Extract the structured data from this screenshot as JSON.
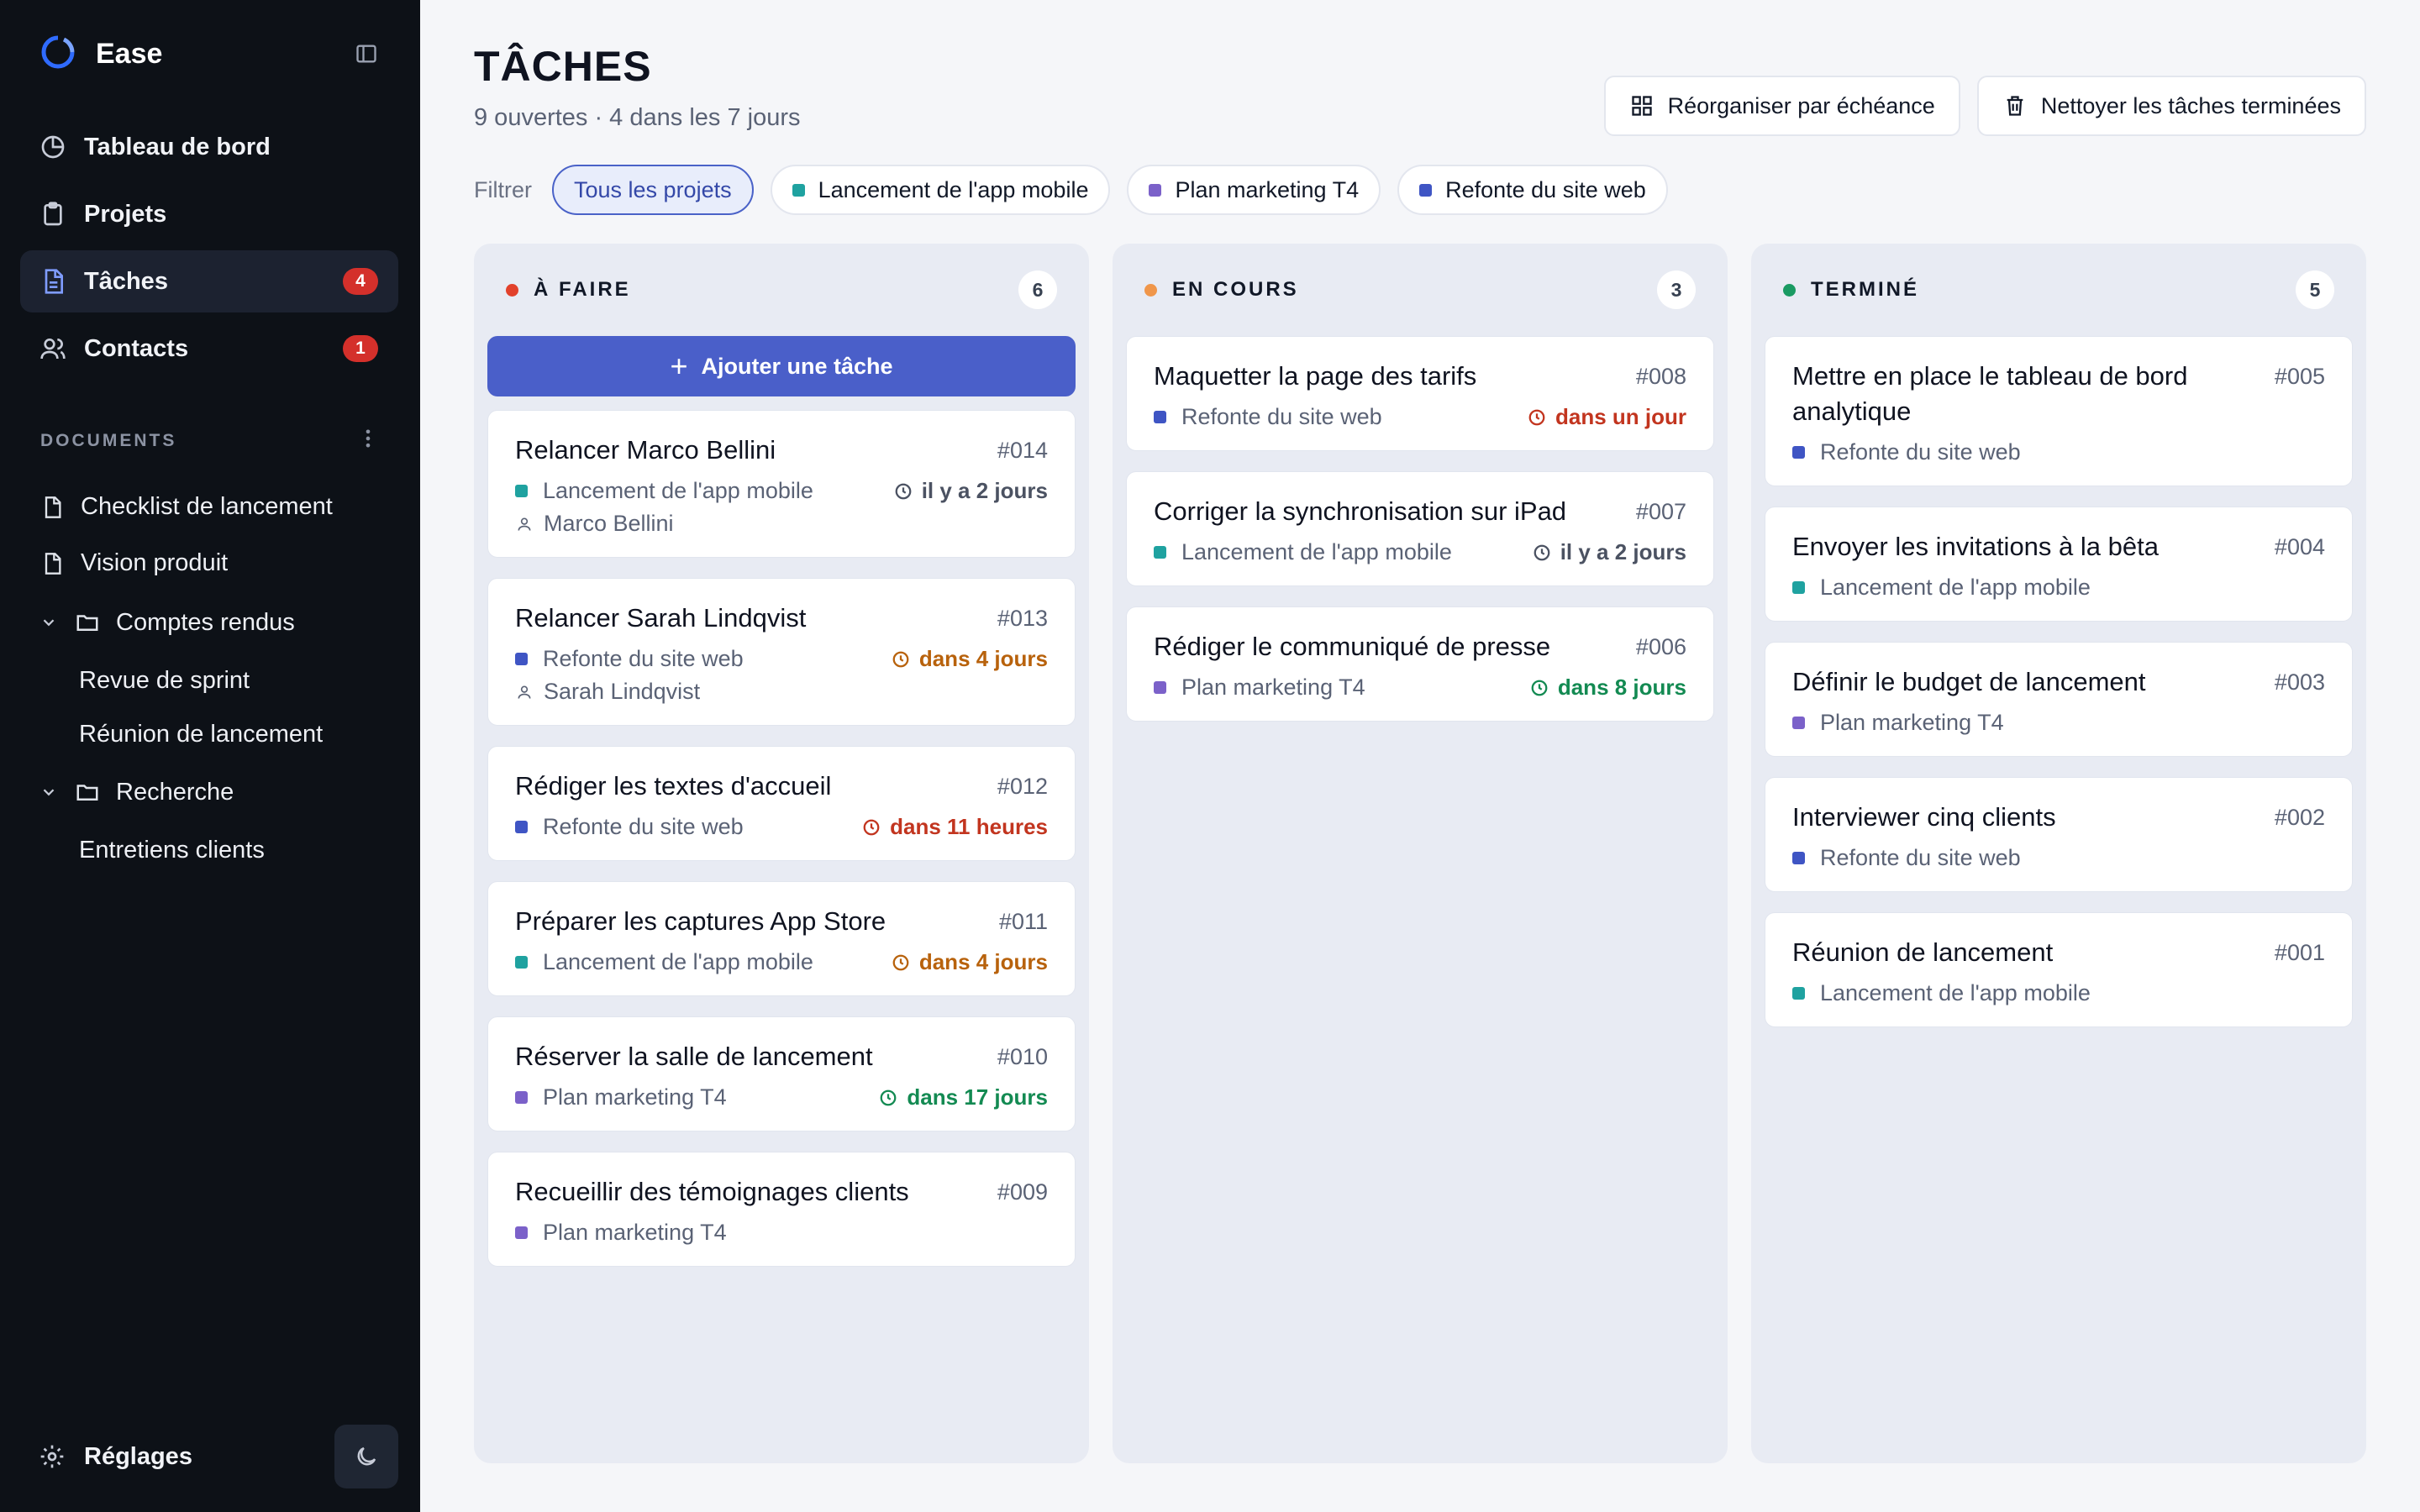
{
  "app": {
    "name": "Ease"
  },
  "colors": {
    "sidebar_bg": "#0d1117",
    "accent": "#4a5fc9",
    "badge_red": "#d4302b",
    "project_mobile": "#1fa2a0",
    "project_marketing": "#7b61c9",
    "project_web": "#3f55c4",
    "due_red": "#c2351f",
    "due_orange": "#b8620c",
    "due_green": "#138a52",
    "due_gray": "#4b5262"
  },
  "sidebar": {
    "nav": [
      {
        "label": "Tableau de bord",
        "icon": "pie-chart-icon",
        "badge": null
      },
      {
        "label": "Projets",
        "icon": "clipboard-icon",
        "badge": null
      },
      {
        "label": "Tâches",
        "icon": "document-icon",
        "badge": "4",
        "active": true
      },
      {
        "label": "Contacts",
        "icon": "users-icon",
        "badge": "1"
      }
    ],
    "documents_label": "DOCUMENTS",
    "docs": {
      "checklist": "Checklist de lancement",
      "vision": "Vision produit",
      "folder_comptes": "Comptes rendus",
      "revue": "Revue de sprint",
      "reunion": "Réunion de lancement",
      "folder_recherche": "Recherche",
      "entretiens": "Entretiens clients"
    },
    "settings_label": "Réglages"
  },
  "page": {
    "title": "TÂCHES",
    "subtitle": "9 ouvertes · 4 dans les 7 jours",
    "reorganize_label": "Réorganiser par échéance",
    "clean_label": "Nettoyer les tâches terminées"
  },
  "filters": {
    "label": "Filtrer",
    "all": "Tous les projets",
    "mobile": "Lancement de l'app mobile",
    "marketing": "Plan marketing T4",
    "web": "Refonte du site web"
  },
  "columns": {
    "todo": {
      "title": "À FAIRE",
      "count": "6",
      "add_label": "Ajouter une tâche",
      "cards": [
        {
          "title": "Relancer Marco Bellini",
          "id": "#014",
          "project": "Lancement de l'app mobile",
          "due": "il y a 2 jours",
          "assignee": "Marco Bellini"
        },
        {
          "title": "Relancer Sarah Lindqvist",
          "id": "#013",
          "project": "Refonte du site web",
          "due": "dans 4 jours",
          "assignee": "Sarah Lindqvist"
        },
        {
          "title": "Rédiger les textes d'accueil",
          "id": "#012",
          "project": "Refonte du site web",
          "due": "dans 11 heures"
        },
        {
          "title": "Préparer les captures App Store",
          "id": "#011",
          "project": "Lancement de l'app mobile",
          "due": "dans 4 jours"
        },
        {
          "title": "Réserver la salle de lancement",
          "id": "#010",
          "project": "Plan marketing T4",
          "due": "dans 17 jours"
        },
        {
          "title": "Recueillir des témoignages clients",
          "id": "#009",
          "project": "Plan marketing T4"
        }
      ]
    },
    "progress": {
      "title": "EN COURS",
      "count": "3",
      "cards": [
        {
          "title": "Maquetter la page des tarifs",
          "id": "#008",
          "project": "Refonte du site web",
          "due": "dans un jour"
        },
        {
          "title": "Corriger la synchronisation sur iPad",
          "id": "#007",
          "project": "Lancement de l'app mobile",
          "due": "il y a 2 jours"
        },
        {
          "title": "Rédiger le communiqué de presse",
          "id": "#006",
          "project": "Plan marketing T4",
          "due": "dans 8 jours"
        }
      ]
    },
    "done": {
      "title": "TERMINÉ",
      "count": "5",
      "cards": [
        {
          "title": "Mettre en place le tableau de bord analytique",
          "id": "#005",
          "project": "Refonte du site web"
        },
        {
          "title": "Envoyer les invitations à la bêta",
          "id": "#004",
          "project": "Lancement de l'app mobile"
        },
        {
          "title": "Définir le budget de lancement",
          "id": "#003",
          "project": "Plan marketing T4"
        },
        {
          "title": "Interviewer cinq clients",
          "id": "#002",
          "project": "Refonte du site web"
        },
        {
          "title": "Réunion de lancement",
          "id": "#001",
          "project": "Lancement de l'app mobile"
        }
      ]
    }
  }
}
